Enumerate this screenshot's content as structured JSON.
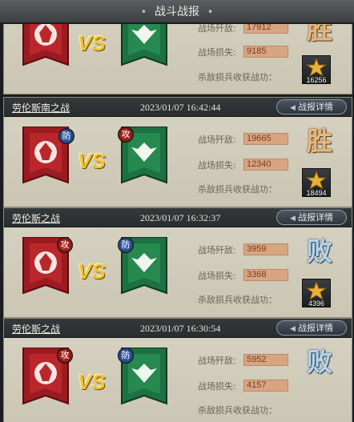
{
  "title": "战斗战报",
  "labels": {
    "kill": "战场歼敌:",
    "loss": "战场损失:",
    "loot": "杀敌损兵收获战功：",
    "detail": "战报详情"
  },
  "cards": [
    {
      "name": "",
      "time": "",
      "red_badge": "",
      "green_badge": "",
      "kill": "17912",
      "loss": "9185",
      "result": "胜",
      "merit": "16256"
    },
    {
      "name": "劳伦斯南之战",
      "time": "2023/01/07 16:42:44",
      "red_badge": "防",
      "green_badge": "攻",
      "kill": "19665",
      "loss": "12340",
      "result": "胜",
      "merit": "18494"
    },
    {
      "name": "劳伦斯之战",
      "time": "2023/01/07 16:32:37",
      "red_badge": "攻",
      "green_badge": "防",
      "kill": "3959",
      "loss": "3368",
      "result": "败",
      "merit": "4396"
    },
    {
      "name": "劳伦斯之战",
      "time": "2023/01/07 16:30:54",
      "red_badge": "攻",
      "green_badge": "防",
      "kill": "5952",
      "loss": "4157",
      "result": "败",
      "merit": ""
    }
  ],
  "vs_text": "VS",
  "colors": {
    "win": "#e6b980",
    "lose": "#b7d4ea",
    "red_banner": "#a01e22",
    "green_banner": "#1f7a45"
  }
}
